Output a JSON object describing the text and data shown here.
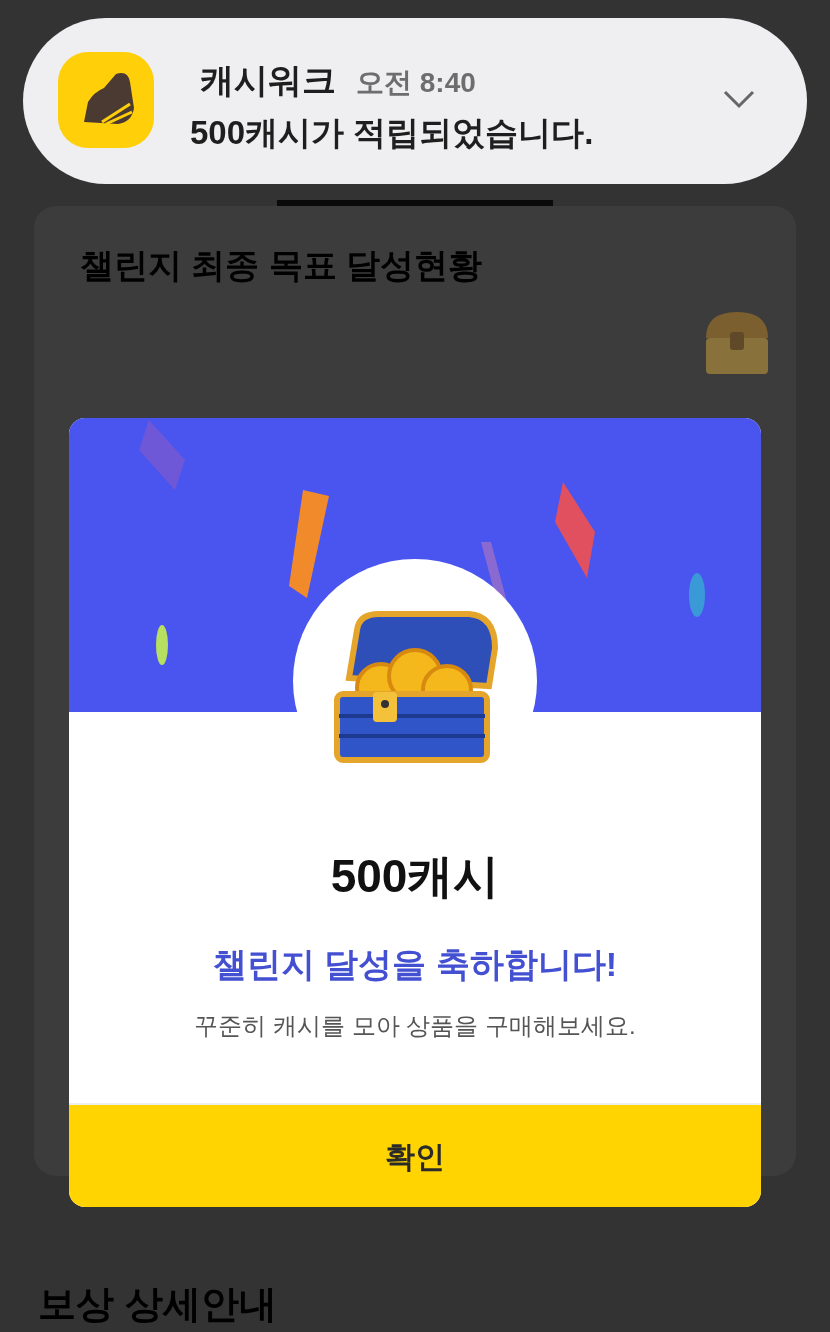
{
  "notification": {
    "app_name": "캐시워크",
    "time": "오전 8:40",
    "message": "500캐시가 적립되었습니다."
  },
  "background": {
    "card_title": "챌린지 최종 목표 달성현황",
    "section_title": "보상 상세안내"
  },
  "dialog": {
    "amount": "500캐시",
    "headline": "챌린지 달성을 축하합니다!",
    "description": "꾸준히 캐시를 모아 상품을 구매해보세요.",
    "button": "확인"
  }
}
